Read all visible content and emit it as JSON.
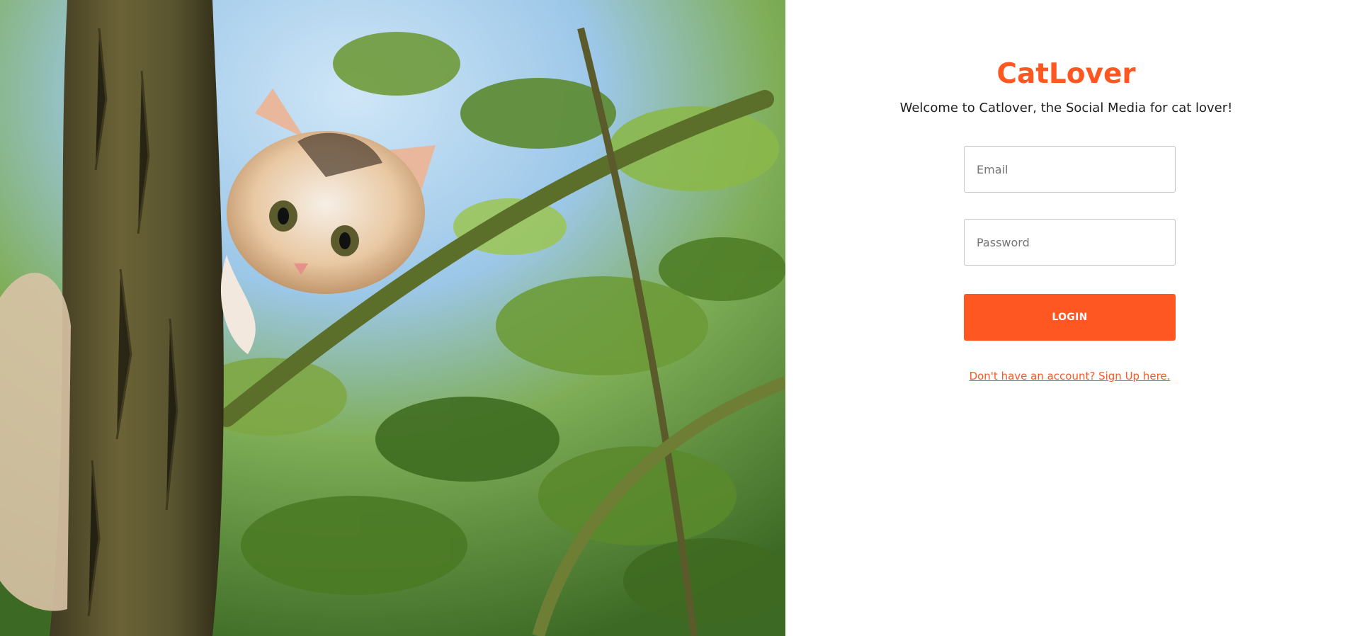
{
  "app": {
    "brand": "CatLover",
    "tagline": "Welcome to Catlover, the Social Media for cat lover!"
  },
  "form": {
    "email_placeholder": "Email",
    "email_value": "",
    "password_placeholder": "Password",
    "password_value": "",
    "login_label": "LOGIN",
    "signup_link": "Don't have an account? Sign Up here."
  },
  "hero": {
    "image_subject": "kitten-in-tree-photo"
  },
  "colors": {
    "accent": "#ff5722",
    "text": "#212121",
    "border": "#c4c4c4",
    "background": "#ffffff"
  }
}
